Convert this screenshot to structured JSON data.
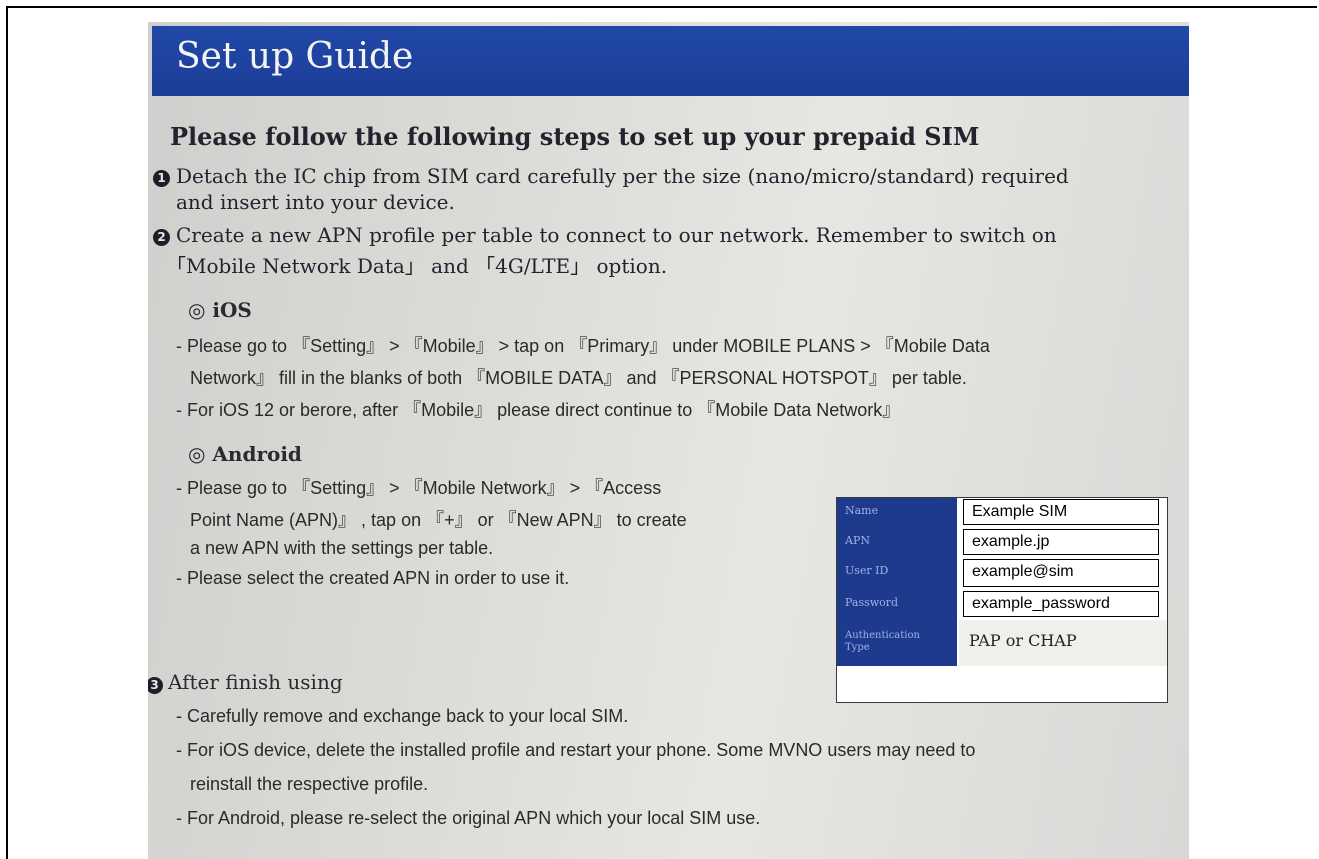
{
  "title": "Set up Guide",
  "heading": "Please follow the following steps to set up your prepaid SIM",
  "step1": {
    "number": "1",
    "line1": "Detach the IC chip from SIM card carefully per the size (nano/micro/standard) required",
    "line2": "and insert into your device."
  },
  "step2": {
    "number": "2",
    "line1": "Create a new APN profile per table to connect to our network. Remember to switch on",
    "line2": "「Mobile Network Data」 and 「4G/LTE」 option."
  },
  "ios": {
    "title": "◎ iOS",
    "lines": [
      "- Please go to 『Setting』 > 『Mobile』 > tap on 『Primary』 under MOBILE PLANS > 『Mobile Data",
      "Network』 fill in the blanks of both 『MOBILE DATA』 and 『PERSONAL HOTSPOT』 per table.",
      "- For iOS 12 or berore, after 『Mobile』 please direct continue to 『Mobile Data Network』"
    ]
  },
  "android": {
    "title": "◎ Android",
    "lines": [
      "- Please go to 『Setting』 > 『Mobile Network』 > 『Access",
      "Point Name (APN)』 , tap on 『+』 or 『New APN』 to create",
      "a new APN with the settings per table.",
      "- Please select the created APN in order to use it."
    ]
  },
  "apn_table": {
    "rows": [
      {
        "label": "Name",
        "value": "Example SIM"
      },
      {
        "label": "APN",
        "value": "example.jp"
      },
      {
        "label": "User ID",
        "value": "example@sim"
      },
      {
        "label": "Password",
        "value": "example_password"
      },
      {
        "label": "Authentication Type",
        "value": "PAP or CHAP"
      }
    ]
  },
  "step3": {
    "number": "3",
    "title": "After finish using",
    "lines": [
      "- Carefully remove and exchange back to your local SIM.",
      "- For iOS device, delete the installed profile and restart your phone. Some MVNO users may need to",
      "reinstall the respective profile.",
      "- For Android, please re-select the original APN which your local SIM use."
    ]
  }
}
